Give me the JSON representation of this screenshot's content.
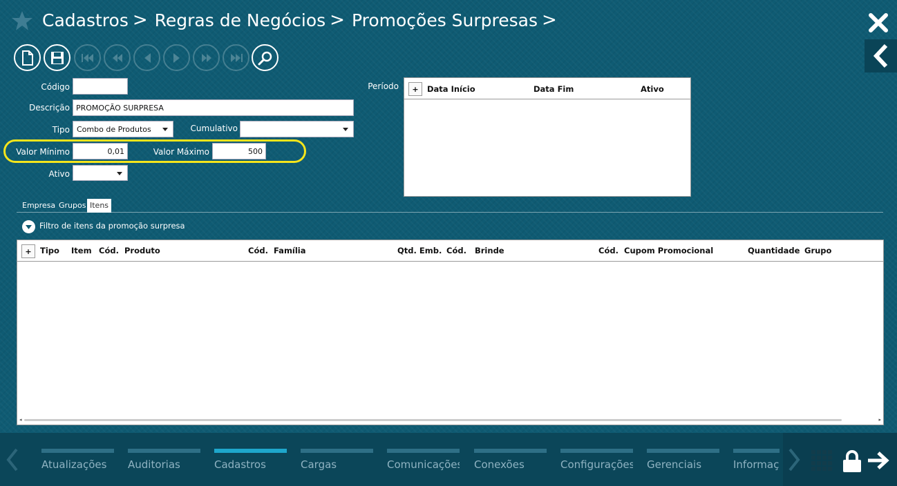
{
  "header": {
    "breadcrumb": [
      "Cadastros",
      "Regras de Negócios",
      "Promoções Surpresas"
    ],
    "separator": ">"
  },
  "form": {
    "codigo_label": "Código",
    "codigo_value": "",
    "descricao_label": "Descrição",
    "descricao_value": "PROMOÇÃO SURPRESA",
    "tipo_label": "Tipo",
    "tipo_value": "Combo de Produtos",
    "cumulativo_label": "Cumulativo",
    "cumulativo_value": "",
    "valor_minimo_label": "Valor Mínimo",
    "valor_minimo_value": "0,01",
    "valor_maximo_label": "Valor Máximo",
    "valor_maximo_value": "500",
    "ativo_label": "Ativo",
    "ativo_value": "",
    "periodo_label": "Período"
  },
  "periodo_grid": {
    "add": "+",
    "columns": [
      "Data Início",
      "Data Fim",
      "Ativo"
    ]
  },
  "tabs": [
    "Empresa",
    "Grupos",
    "Itens"
  ],
  "active_tab": "Itens",
  "filter_label": "Filtro de itens da promoção surpresa",
  "items_grid": {
    "add": "+",
    "columns": [
      "Tipo",
      "Item",
      "Cód.",
      "Produto",
      "Cód.",
      "Família",
      "Qtd. Emb.",
      "Cód.",
      "Brinde",
      "Cód.",
      "Cupom Promocional",
      "Quantidade",
      "Grupo"
    ]
  },
  "bottom_nav": {
    "items": [
      "Atualizações",
      "Auditorias",
      "Cadastros",
      "Cargas",
      "Comunicações",
      "Conexões",
      "Configurações",
      "Gerenciais",
      "Informações"
    ],
    "active": "Cadastros"
  },
  "colors": {
    "background": "#0f5b73",
    "highlight": "#f5e51b",
    "nav_active": "#1ea7cc"
  }
}
